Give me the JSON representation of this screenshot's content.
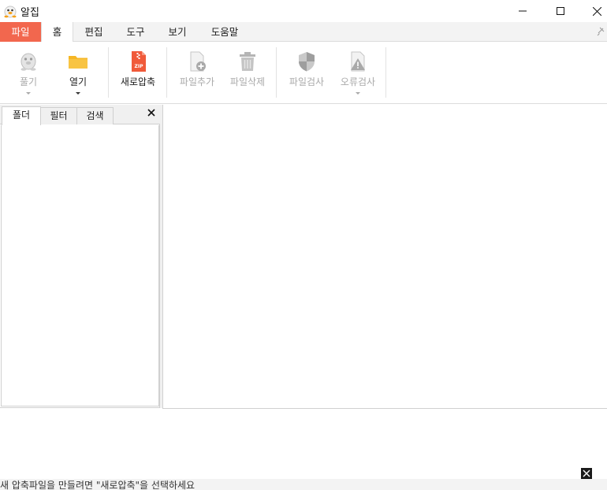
{
  "window": {
    "title": "알집",
    "minimize_icon": "minimize-icon",
    "maximize_icon": "maximize-icon",
    "close_icon": "close-icon"
  },
  "menu_tabs": [
    {
      "label": "파일",
      "active": false,
      "accent": true
    },
    {
      "label": "홈",
      "active": true
    },
    {
      "label": "편집"
    },
    {
      "label": "도구"
    },
    {
      "label": "보기"
    },
    {
      "label": "도움말"
    }
  ],
  "ribbon": {
    "extract": {
      "label": "풀기",
      "icon": "ghost-mascot-icon",
      "enabled": false,
      "has_dropdown": true
    },
    "open": {
      "label": "열기",
      "icon": "folder-icon",
      "enabled": true,
      "has_dropdown": true
    },
    "new_archive": {
      "label": "새로압축",
      "icon": "zip-file-icon",
      "enabled": true
    },
    "add_file": {
      "label": "파일추가",
      "icon": "add-file-icon",
      "enabled": false
    },
    "delete_file": {
      "label": "파일삭제",
      "icon": "trash-icon",
      "enabled": false
    },
    "scan_file": {
      "label": "파일검사",
      "icon": "shield-icon",
      "enabled": false
    },
    "check_errors": {
      "label": "오류검사",
      "icon": "warning-file-icon",
      "enabled": false,
      "has_dropdown": true
    }
  },
  "left_panel": {
    "tabs": [
      {
        "label": "폴더",
        "active": true
      },
      {
        "label": "필터"
      },
      {
        "label": "검색"
      }
    ]
  },
  "status": {
    "text": "새 압축파일을 만들려면 \"새로압축\"을 선택하세요"
  },
  "colors": {
    "accent": "#f2674e",
    "folder": "#f6b624",
    "zip": "#f05a3a",
    "disabled": "#a9a9a9"
  }
}
